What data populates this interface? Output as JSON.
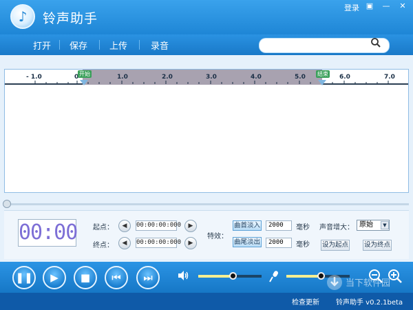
{
  "app": {
    "title": "铃声助手",
    "logo_glyph": "♪",
    "brand_color": "#1e86d6"
  },
  "titlebar": {
    "login": "登录",
    "btn_settings": "▣",
    "btn_minimize": "—",
    "btn_close": "✕"
  },
  "menu": {
    "items": [
      "打开",
      "保存",
      "上传",
      "录音"
    ],
    "search_placeholder": ""
  },
  "timeline": {
    "ticks": [
      "- 1.0",
      "0",
      "1.0",
      "2.0",
      "3.0",
      "4.0",
      "5.0",
      "6.0",
      "7.0"
    ],
    "start_marker": "开始",
    "end_marker": "结束"
  },
  "controls": {
    "time_display": "00:00",
    "start_label": "起点：",
    "end_label": "终点：",
    "start_time": "00:00:00:000",
    "end_time": "00:00:00:000",
    "prev_glyph": "◀",
    "next_glyph": "▶",
    "effects_label": "特效：",
    "fade_in": "曲首淡入",
    "fade_out": "曲尾淡出",
    "fade_in_ms": "2000",
    "fade_out_ms": "2000",
    "ms_unit": "毫秒",
    "volume_label": "声音增大：",
    "volume_option": "原始",
    "set_start": "设为起点",
    "set_end": "设为终点"
  },
  "transport": {
    "pause": "❚❚",
    "play": "▶",
    "stop": "■",
    "prev": "⏮",
    "next": "⏭",
    "volume_level": 0.55,
    "mic_level": 0.55
  },
  "status": {
    "check_update": "检查更新",
    "version": "铃声助手 v0.2.1beta"
  },
  "watermark": "当下软件园"
}
